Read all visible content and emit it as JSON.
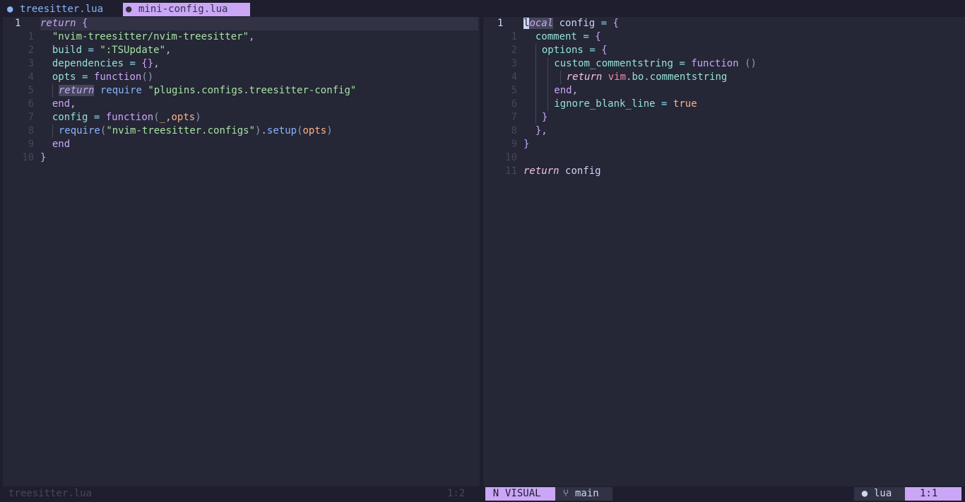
{
  "tabs": [
    {
      "label": "treesitter.lua",
      "icon": "lua-file-icon",
      "active": false
    },
    {
      "label": "mini-config.lua",
      "icon": "lua-file-icon",
      "active": true
    }
  ],
  "left_window": {
    "line_numbers": [
      "1",
      "1",
      "2",
      "3",
      "4",
      "5",
      "6",
      "7",
      "8",
      "9",
      "10"
    ]
  },
  "right_window": {
    "line_numbers": [
      "1",
      "1",
      "2",
      "3",
      "4",
      "5",
      "6",
      "7",
      "8",
      "9",
      "10",
      "11"
    ]
  },
  "code": {
    "return": "return",
    "local": "local",
    "function": "function",
    "end": "end",
    "true": "true",
    "require": "require",
    "left_l1_path": "\"nvim-treesitter/nvim-treesitter\"",
    "left_l2_key": "build",
    "left_l2_val": "\":TSUpdate\"",
    "left_l3_key": "dependencies",
    "left_l4_key": "opts",
    "left_l5_str": "\"plugins.configs.treesitter-config\"",
    "left_l7_key": "config",
    "left_l7_p1": "_",
    "left_l7_p2": "opts",
    "left_l8_str": "\"nvim-treesitter.configs\"",
    "left_l8_method": "setup",
    "left_l8_arg": "opts",
    "right_var": "config",
    "right_l1_key": "comment",
    "right_l2_key": "options",
    "right_l3_key": "custom_commentstring",
    "right_l4_vim": "vim",
    "right_l4_bo": "bo",
    "right_l4_cs": "commentstring",
    "right_l6_key": "ignore_blank_line"
  },
  "status": {
    "left_file": "treesitter.lua",
    "left_pos": "1:2",
    "mode": "VISUAL",
    "branch": "main",
    "filetype": "lua",
    "position": "1:1"
  },
  "colors": {
    "background": "#1e1e2e",
    "accent": "#cba6f7",
    "tab_inactive": "#89b4fa"
  }
}
